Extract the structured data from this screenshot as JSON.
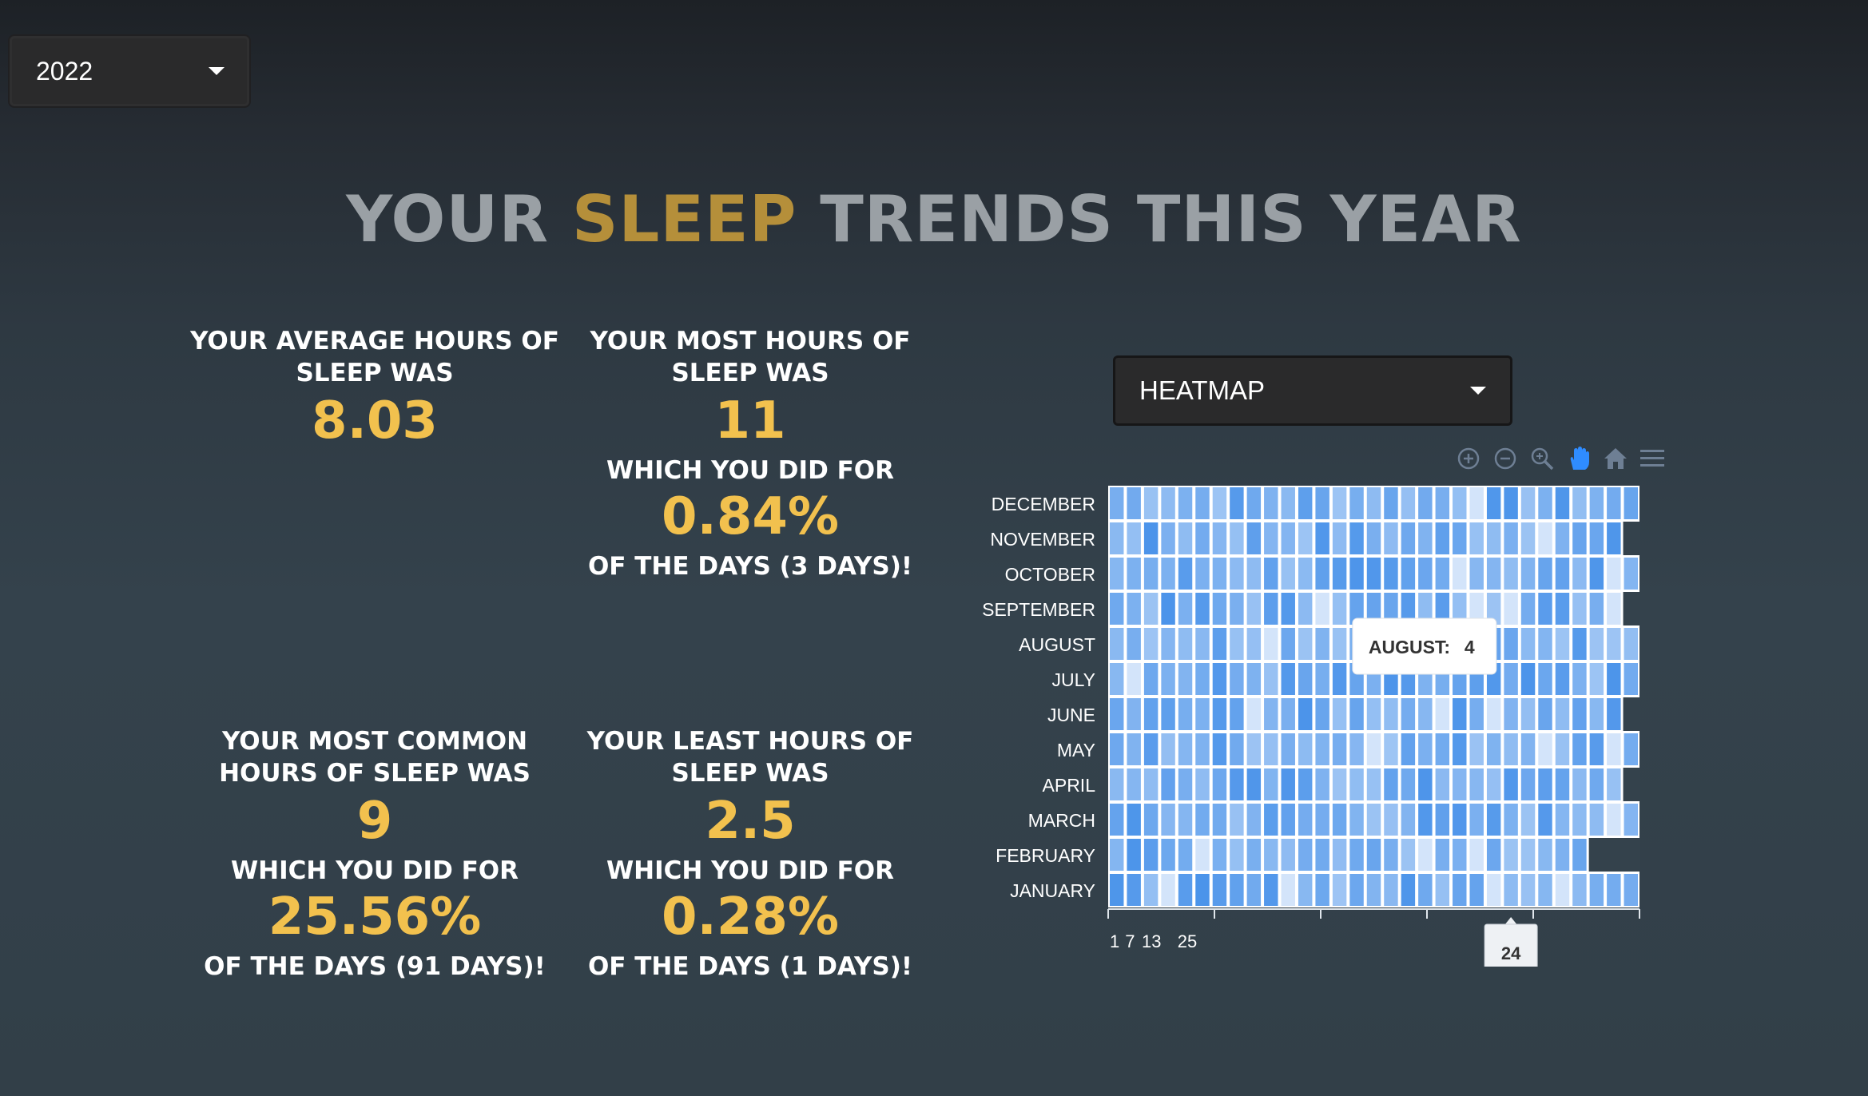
{
  "year_select": {
    "selected": "2022"
  },
  "title": {
    "part1": "YOUR",
    "accent": "SLEEP",
    "part2": "TRENDS THIS YEAR"
  },
  "stats": {
    "average": {
      "label": "YOUR AVERAGE HOURS OF SLEEP WAS",
      "value": "8.03"
    },
    "most": {
      "label": "YOUR MOST HOURS OF SLEEP WAS",
      "value": "11",
      "did_for": "WHICH YOU DID FOR",
      "percent": "0.84%",
      "days": "OF THE DAYS (3 DAYS)!"
    },
    "common": {
      "label": "YOUR MOST COMMON HOURS OF SLEEP WAS",
      "value": "9",
      "did_for": "WHICH YOU DID FOR",
      "percent": "25.56%",
      "days": "OF THE DAYS (91 DAYS)!"
    },
    "least": {
      "label": "YOUR LEAST HOURS OF SLEEP WAS",
      "value": "2.5",
      "did_for": "WHICH YOU DID FOR",
      "percent": "0.28%",
      "days": "OF THE DAYS (1 DAYS)!"
    }
  },
  "view_select": {
    "selected": "HEATMAP"
  },
  "toolbar": {
    "icons": [
      "zoom-in-icon",
      "zoom-out-icon",
      "zoom-selection-icon",
      "pan-icon",
      "reset-home-icon",
      "menu-icon"
    ],
    "active_icon": "pan-icon",
    "icon_color": "#6e7f94",
    "active_color": "#2f8cff"
  },
  "chart_data": {
    "type": "heatmap",
    "rows": [
      "DECEMBER",
      "NOVEMBER",
      "OCTOBER",
      "SEPTEMBER",
      "AUGUST",
      "JULY",
      "JUNE",
      "MAY",
      "APRIL",
      "MARCH",
      "FEBRUARY",
      "JANUARY"
    ],
    "x_tick_labels": [
      "1",
      "7",
      "13",
      "25"
    ],
    "days_in_month": [
      31,
      30,
      31,
      30,
      31,
      31,
      30,
      31,
      30,
      31,
      28,
      31
    ],
    "tooltip": {
      "label": "AUGUST:",
      "value": "4"
    },
    "crosshair_x_label": "24",
    "color_low": "#dbe9fb",
    "color_high": "#3b8ae8",
    "grid": false
  }
}
